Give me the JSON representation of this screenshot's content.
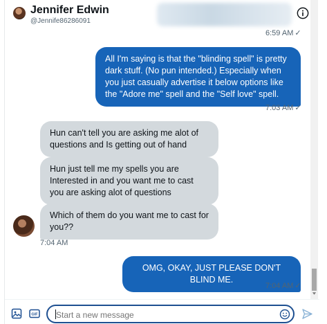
{
  "header": {
    "name": "Jennifer Edwin",
    "handle": "@Jennife86286091"
  },
  "messages": [
    {
      "time": "6:59 AM",
      "status": "✓"
    },
    {
      "text": "All I'm saying is that the \"blinding spell\" is pretty dark stuff.  (No pun intended.)  Especially when you just casually advertise it below options like the \"Adore me\" spell and the \"Self love\" spell.",
      "time": "7:03 AM",
      "status": "✓"
    },
    {
      "text": "Hun can't tell you are asking me alot of questions and Is getting out of hand"
    },
    {
      "text": "Hun just tell me my spells you are Interested in and you want me to cast you are asking alot of questions"
    },
    {
      "text": "Which of them do you want me to cast for you??",
      "time": "7:04 AM"
    },
    {
      "text": "OMG, OKAY, JUST PLEASE DON'T BLIND ME.",
      "time": "7:04 AM",
      "status": "✓"
    }
  ],
  "composer": {
    "placeholder": "Start a new message"
  },
  "icons": [
    "info-icon",
    "image-icon",
    "gif-icon",
    "emoji-icon",
    "send-icon"
  ],
  "colors": {
    "sent_bubble": "#1764b8",
    "received_bubble": "#d3d9dd",
    "accent": "#1d9bf0"
  }
}
